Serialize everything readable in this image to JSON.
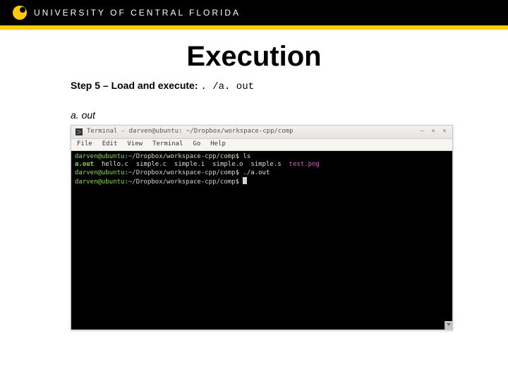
{
  "header": {
    "university": "UNIVERSITY OF CENTRAL FLORIDA"
  },
  "slide": {
    "title": "Execution",
    "step_prefix": "Step 5 – Load and execute: ",
    "step_cmd": ". /a. out",
    "file_label": "a. out"
  },
  "terminal": {
    "titlebar": "Terminal - darven@ubuntu: ~/Dropbox/workspace-cpp/comp",
    "win_buttons": {
      "min": "–",
      "max": "+",
      "close": "×"
    },
    "menus": [
      "File",
      "Edit",
      "View",
      "Terminal",
      "Go",
      "Help"
    ],
    "prompt_user": "darven@ubuntu",
    "prompt_sep": ":",
    "prompt_path": "~/Dropbox/workspace-cpp/comp",
    "prompt_suffix": "$",
    "lines": [
      {
        "cmd": "ls"
      },
      {
        "listing": [
          {
            "text": "a.out",
            "class": "exe-green"
          },
          {
            "text": "hello.c"
          },
          {
            "text": "simple.c"
          },
          {
            "text": "simple.i"
          },
          {
            "text": "simple.o"
          },
          {
            "text": "simple.s"
          },
          {
            "text": "test.png",
            "class": "pink"
          }
        ]
      },
      {
        "cmd": "./a.out"
      },
      {
        "cmd": ""
      }
    ]
  }
}
